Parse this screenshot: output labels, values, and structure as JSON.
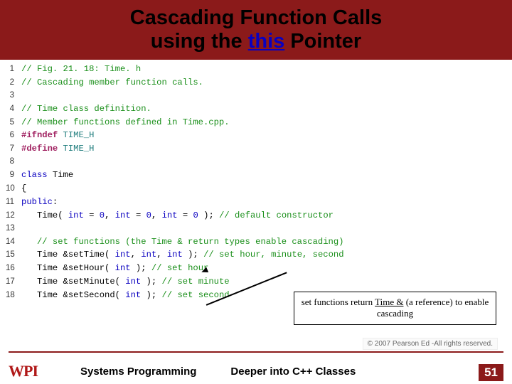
{
  "title": {
    "line1": "Cascading Function Calls",
    "line2_pre": "using the ",
    "line2_kw": "this",
    "line2_post": " Pointer"
  },
  "code": {
    "lines": [
      {
        "n": "1",
        "tokens": [
          {
            "cls": "c-comment",
            "t": "// Fig. 21. 18: Time. h"
          }
        ]
      },
      {
        "n": "2",
        "tokens": [
          {
            "cls": "c-comment",
            "t": "// Cascading member function calls."
          }
        ]
      },
      {
        "n": "3",
        "tokens": []
      },
      {
        "n": "4",
        "tokens": [
          {
            "cls": "c-comment",
            "t": "// Time class definition."
          }
        ]
      },
      {
        "n": "5",
        "tokens": [
          {
            "cls": "c-comment",
            "t": "// Member functions defined in Time.cpp."
          }
        ]
      },
      {
        "n": "6",
        "tokens": [
          {
            "cls": "c-pp",
            "t": "#ifndef "
          },
          {
            "cls": "c-macro",
            "t": "TIME_H"
          }
        ]
      },
      {
        "n": "7",
        "tokens": [
          {
            "cls": "c-pp",
            "t": "#define "
          },
          {
            "cls": "c-macro",
            "t": "TIME_H"
          }
        ]
      },
      {
        "n": "8",
        "tokens": []
      },
      {
        "n": "9",
        "tokens": [
          {
            "cls": "c-kw",
            "t": "class"
          },
          {
            "cls": "c-black",
            "t": " Time"
          }
        ]
      },
      {
        "n": "10",
        "tokens": [
          {
            "cls": "c-black",
            "t": "{"
          }
        ]
      },
      {
        "n": "11",
        "tokens": [
          {
            "cls": "c-kw",
            "t": "public"
          },
          {
            "cls": "c-black",
            "t": ":"
          }
        ]
      },
      {
        "n": "12",
        "tokens": [
          {
            "cls": "c-black",
            "t": "   Time( "
          },
          {
            "cls": "c-kw",
            "t": "int"
          },
          {
            "cls": "c-black",
            "t": " = "
          },
          {
            "cls": "c-kw",
            "t": "0"
          },
          {
            "cls": "c-black",
            "t": ", "
          },
          {
            "cls": "c-kw",
            "t": "int"
          },
          {
            "cls": "c-black",
            "t": " = "
          },
          {
            "cls": "c-kw",
            "t": "0"
          },
          {
            "cls": "c-black",
            "t": ", "
          },
          {
            "cls": "c-kw",
            "t": "int"
          },
          {
            "cls": "c-black",
            "t": " = "
          },
          {
            "cls": "c-kw",
            "t": "0"
          },
          {
            "cls": "c-black",
            "t": " ); "
          },
          {
            "cls": "c-comment",
            "t": "// default constructor"
          }
        ]
      },
      {
        "n": "13",
        "tokens": []
      },
      {
        "n": "14",
        "tokens": [
          {
            "cls": "c-black",
            "t": "   "
          },
          {
            "cls": "c-comment",
            "t": "// set functions (the Time & return types enable cascading)"
          }
        ]
      },
      {
        "n": "15",
        "tokens": [
          {
            "cls": "c-black",
            "t": "   Time &setTime( "
          },
          {
            "cls": "c-kw",
            "t": "int"
          },
          {
            "cls": "c-black",
            "t": ", "
          },
          {
            "cls": "c-kw",
            "t": "int"
          },
          {
            "cls": "c-black",
            "t": ", "
          },
          {
            "cls": "c-kw",
            "t": "int"
          },
          {
            "cls": "c-black",
            "t": " ); "
          },
          {
            "cls": "c-comment",
            "t": "// set hour, minute, second"
          }
        ]
      },
      {
        "n": "16",
        "tokens": [
          {
            "cls": "c-black",
            "t": "   Time &setHour( "
          },
          {
            "cls": "c-kw",
            "t": "int"
          },
          {
            "cls": "c-black",
            "t": " ); "
          },
          {
            "cls": "c-comment",
            "t": "// set hour"
          }
        ]
      },
      {
        "n": "17",
        "tokens": [
          {
            "cls": "c-black",
            "t": "   Time &setMinute( "
          },
          {
            "cls": "c-kw",
            "t": "int"
          },
          {
            "cls": "c-black",
            "t": " ); "
          },
          {
            "cls": "c-comment",
            "t": "// set minute"
          }
        ]
      },
      {
        "n": "18",
        "tokens": [
          {
            "cls": "c-black",
            "t": "   Time &setSecond( "
          },
          {
            "cls": "c-kw",
            "t": "int"
          },
          {
            "cls": "c-black",
            "t": " ); "
          },
          {
            "cls": "c-comment",
            "t": "// set second"
          }
        ]
      }
    ]
  },
  "callout": {
    "text_pre": "set functions return ",
    "text_ul": "Time &",
    "text_mid": " (a reference) to enable cascading"
  },
  "copyright": "© 2007 Pearson Ed -All rights reserved.",
  "footer": {
    "logo_text": "WPI",
    "left": "Systems Programming",
    "right": "Deeper into C++ Classes",
    "page": "51"
  }
}
